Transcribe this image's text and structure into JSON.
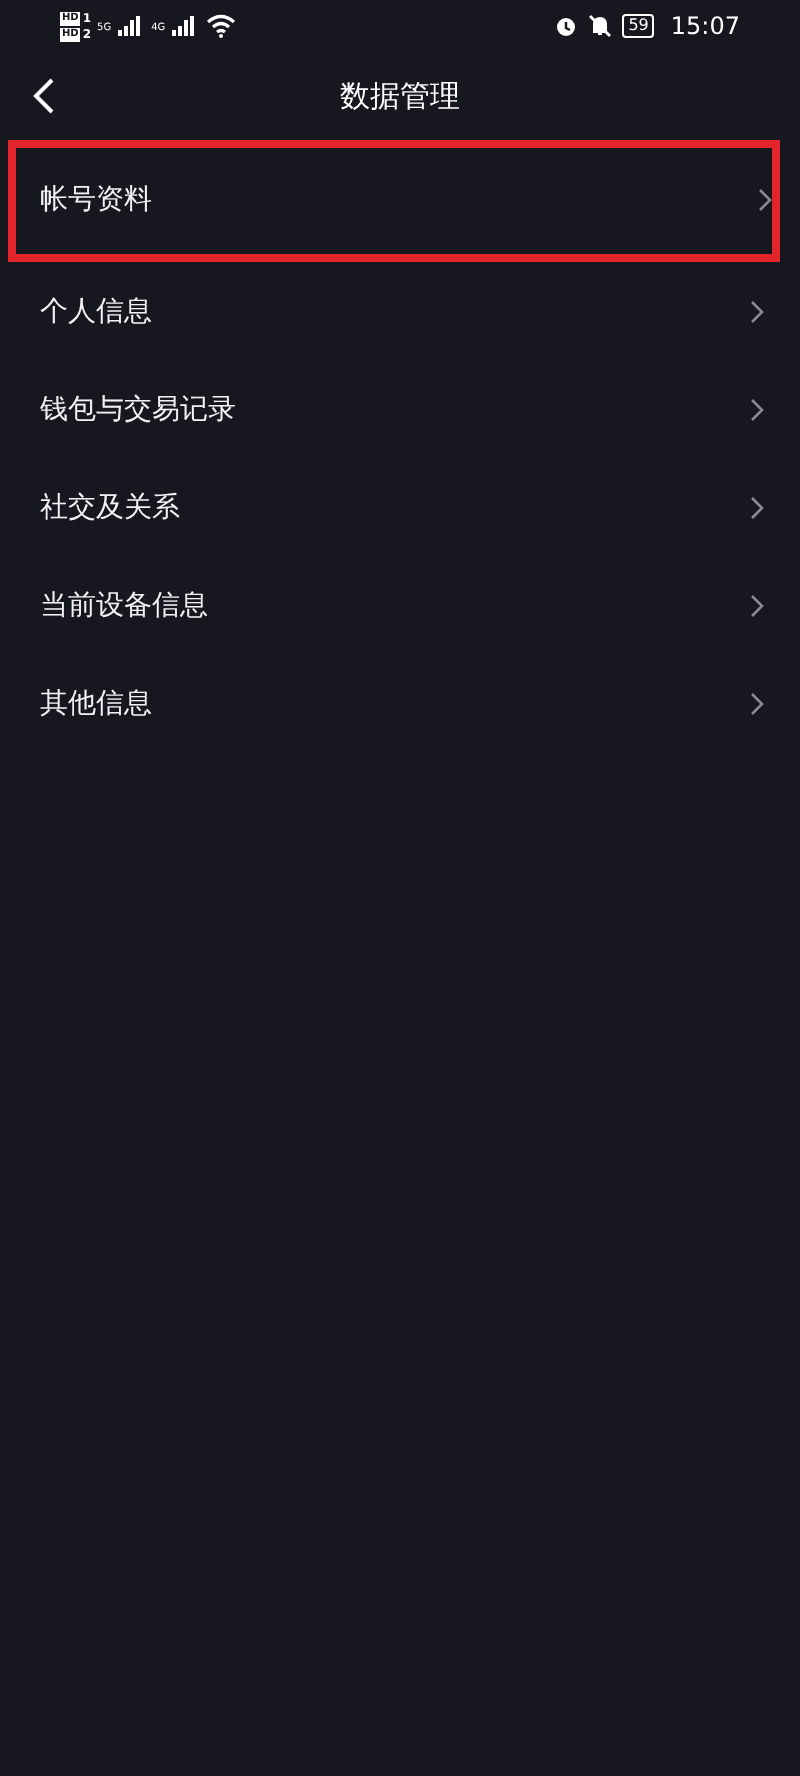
{
  "status_bar": {
    "sim_1": "HD",
    "sim_1_slot": "1",
    "sim_2": "HD",
    "sim_2_slot": "2",
    "network_1": "5G",
    "network_2": "4G",
    "battery": "59",
    "time": "15:07"
  },
  "header": {
    "title": "数据管理"
  },
  "items": [
    {
      "label": "帐号资料",
      "highlighted": true
    },
    {
      "label": "个人信息",
      "highlighted": false
    },
    {
      "label": "钱包与交易记录",
      "highlighted": false
    },
    {
      "label": "社交及关系",
      "highlighted": false
    },
    {
      "label": "当前设备信息",
      "highlighted": false
    },
    {
      "label": "其他信息",
      "highlighted": false
    }
  ]
}
